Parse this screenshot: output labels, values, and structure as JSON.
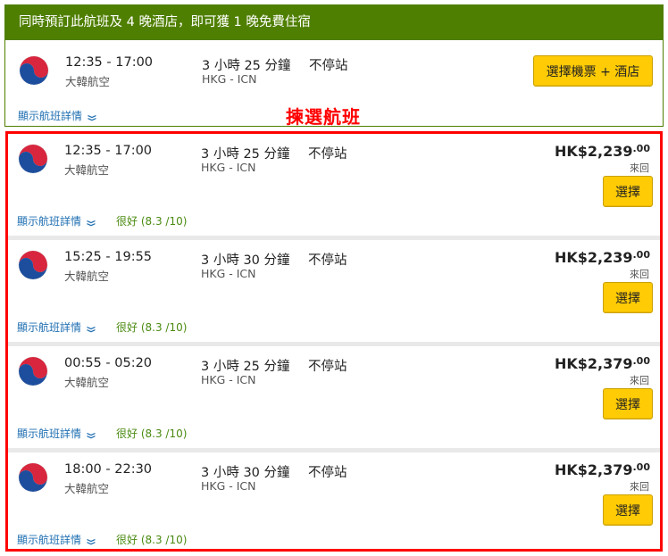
{
  "promo": {
    "banner": "同時預訂此航班及 4 晚酒店，即可獲 1 晚免費住宿",
    "time": "12:35 - 17:00",
    "airline": "大韓航空",
    "duration": "3 小時 25 分鐘",
    "route": "HKG - ICN",
    "stops": "不停站",
    "button_label": "選擇機票 + 酒店",
    "details_label": "顯示航班詳情"
  },
  "annotation": "揀選航班",
  "flights": [
    {
      "time": "12:35 - 17:00",
      "airline": "大韓航空",
      "duration": "3 小時 25 分鐘",
      "route": "HKG - ICN",
      "stops": "不停站",
      "price_main": "HK$2,239",
      "price_decimal": ".00",
      "trip_type": "來回",
      "button_label": "選擇",
      "details_label": "顯示航班詳情",
      "rating": "很好 (8.3 /10)"
    },
    {
      "time": "15:25 - 19:55",
      "airline": "大韓航空",
      "duration": "3 小時 30 分鐘",
      "route": "HKG - ICN",
      "stops": "不停站",
      "price_main": "HK$2,239",
      "price_decimal": ".00",
      "trip_type": "來回",
      "button_label": "選擇",
      "details_label": "顯示航班詳情",
      "rating": "很好 (8.3 /10)"
    },
    {
      "time": "00:55 - 05:20",
      "airline": "大韓航空",
      "duration": "3 小時 25 分鐘",
      "route": "HKG - ICN",
      "stops": "不停站",
      "price_main": "HK$2,379",
      "price_decimal": ".00",
      "trip_type": "來回",
      "button_label": "選擇",
      "details_label": "顯示航班詳情",
      "rating": "很好 (8.3 /10)"
    },
    {
      "time": "18:00 - 22:30",
      "airline": "大韓航空",
      "duration": "3 小時 30 分鐘",
      "route": "HKG - ICN",
      "stops": "不停站",
      "price_main": "HK$2,379",
      "price_decimal": ".00",
      "trip_type": "來回",
      "button_label": "選擇",
      "details_label": "顯示航班詳情",
      "rating": "很好 (8.3 /10)"
    }
  ],
  "icons": {
    "airline_logo": "korean-air-logo-icon",
    "expand": "chevron-down-icon"
  },
  "colors": {
    "promo_green": "#4f7f00",
    "button_yellow": "#ffcb05",
    "link_blue": "#1f6fb2",
    "rating_green": "#4a8a10",
    "highlight_red": "#ff0000"
  }
}
